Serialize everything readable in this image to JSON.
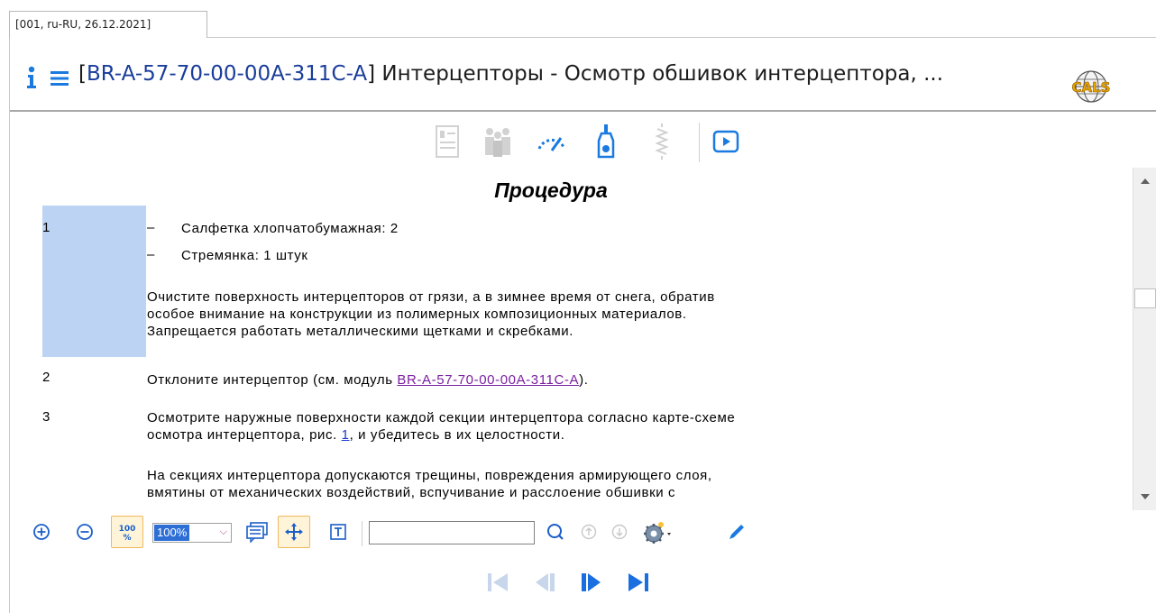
{
  "tab": {
    "label": "[001, ru-RU, 26.12.2021]"
  },
  "header": {
    "code": "BR-A-57-70-00-00A-311C-A",
    "title_rest": "] Интерцепторы - Осмотр обшивок интерцептора, ...",
    "bracket_open": "["
  },
  "toolbar_top": {
    "icons": [
      "document-info-icon",
      "people-icon",
      "gauge-icon",
      "bottle-icon",
      "spring-icon",
      "play-icon"
    ]
  },
  "content": {
    "heading": "Процедура",
    "steps": [
      {
        "num": "1",
        "items": [
          "Салфетка хлопчатобумажная: 2",
          "Стремянка: 1 штук"
        ],
        "dash": "–",
        "paragraph": [
          "Очистите поверхность интерцепторов от грязи, а в зимнее время от снега, обратив",
          "особое внимание на конструкции из полимерных композиционных материалов.",
          "Запрещается работать металлическими щетками и скребками."
        ]
      },
      {
        "num": "2",
        "text_before": "Отклоните интерцептор (см. модуль ",
        "link": "BR-A-57-70-00-00A-311C-A",
        "text_after": ")."
      },
      {
        "num": "3",
        "line1": "Осмотрите наружные поверхности каждой секции интерцептора согласно карте-схеме",
        "line2_before": "осмотра интерцептора, рис. ",
        "fig_link": "1",
        "line2_after": ", и убедитесь в их целостности.",
        "note1": "На секциях интерцептора допускаются трещины, повреждения армирующего слоя,",
        "note2": "вмятины от механических воздействий, вспучивание и расслоение обшивки с"
      }
    ]
  },
  "bottom_toolbar": {
    "zoom_fit_label": "100%",
    "zoom_value": "100%",
    "search_placeholder": ""
  },
  "colors": {
    "accent": "#1a7ae0",
    "highlight": "#bcd3f4",
    "link": "#7a1fa0",
    "active_bg": "#fff4d8"
  }
}
